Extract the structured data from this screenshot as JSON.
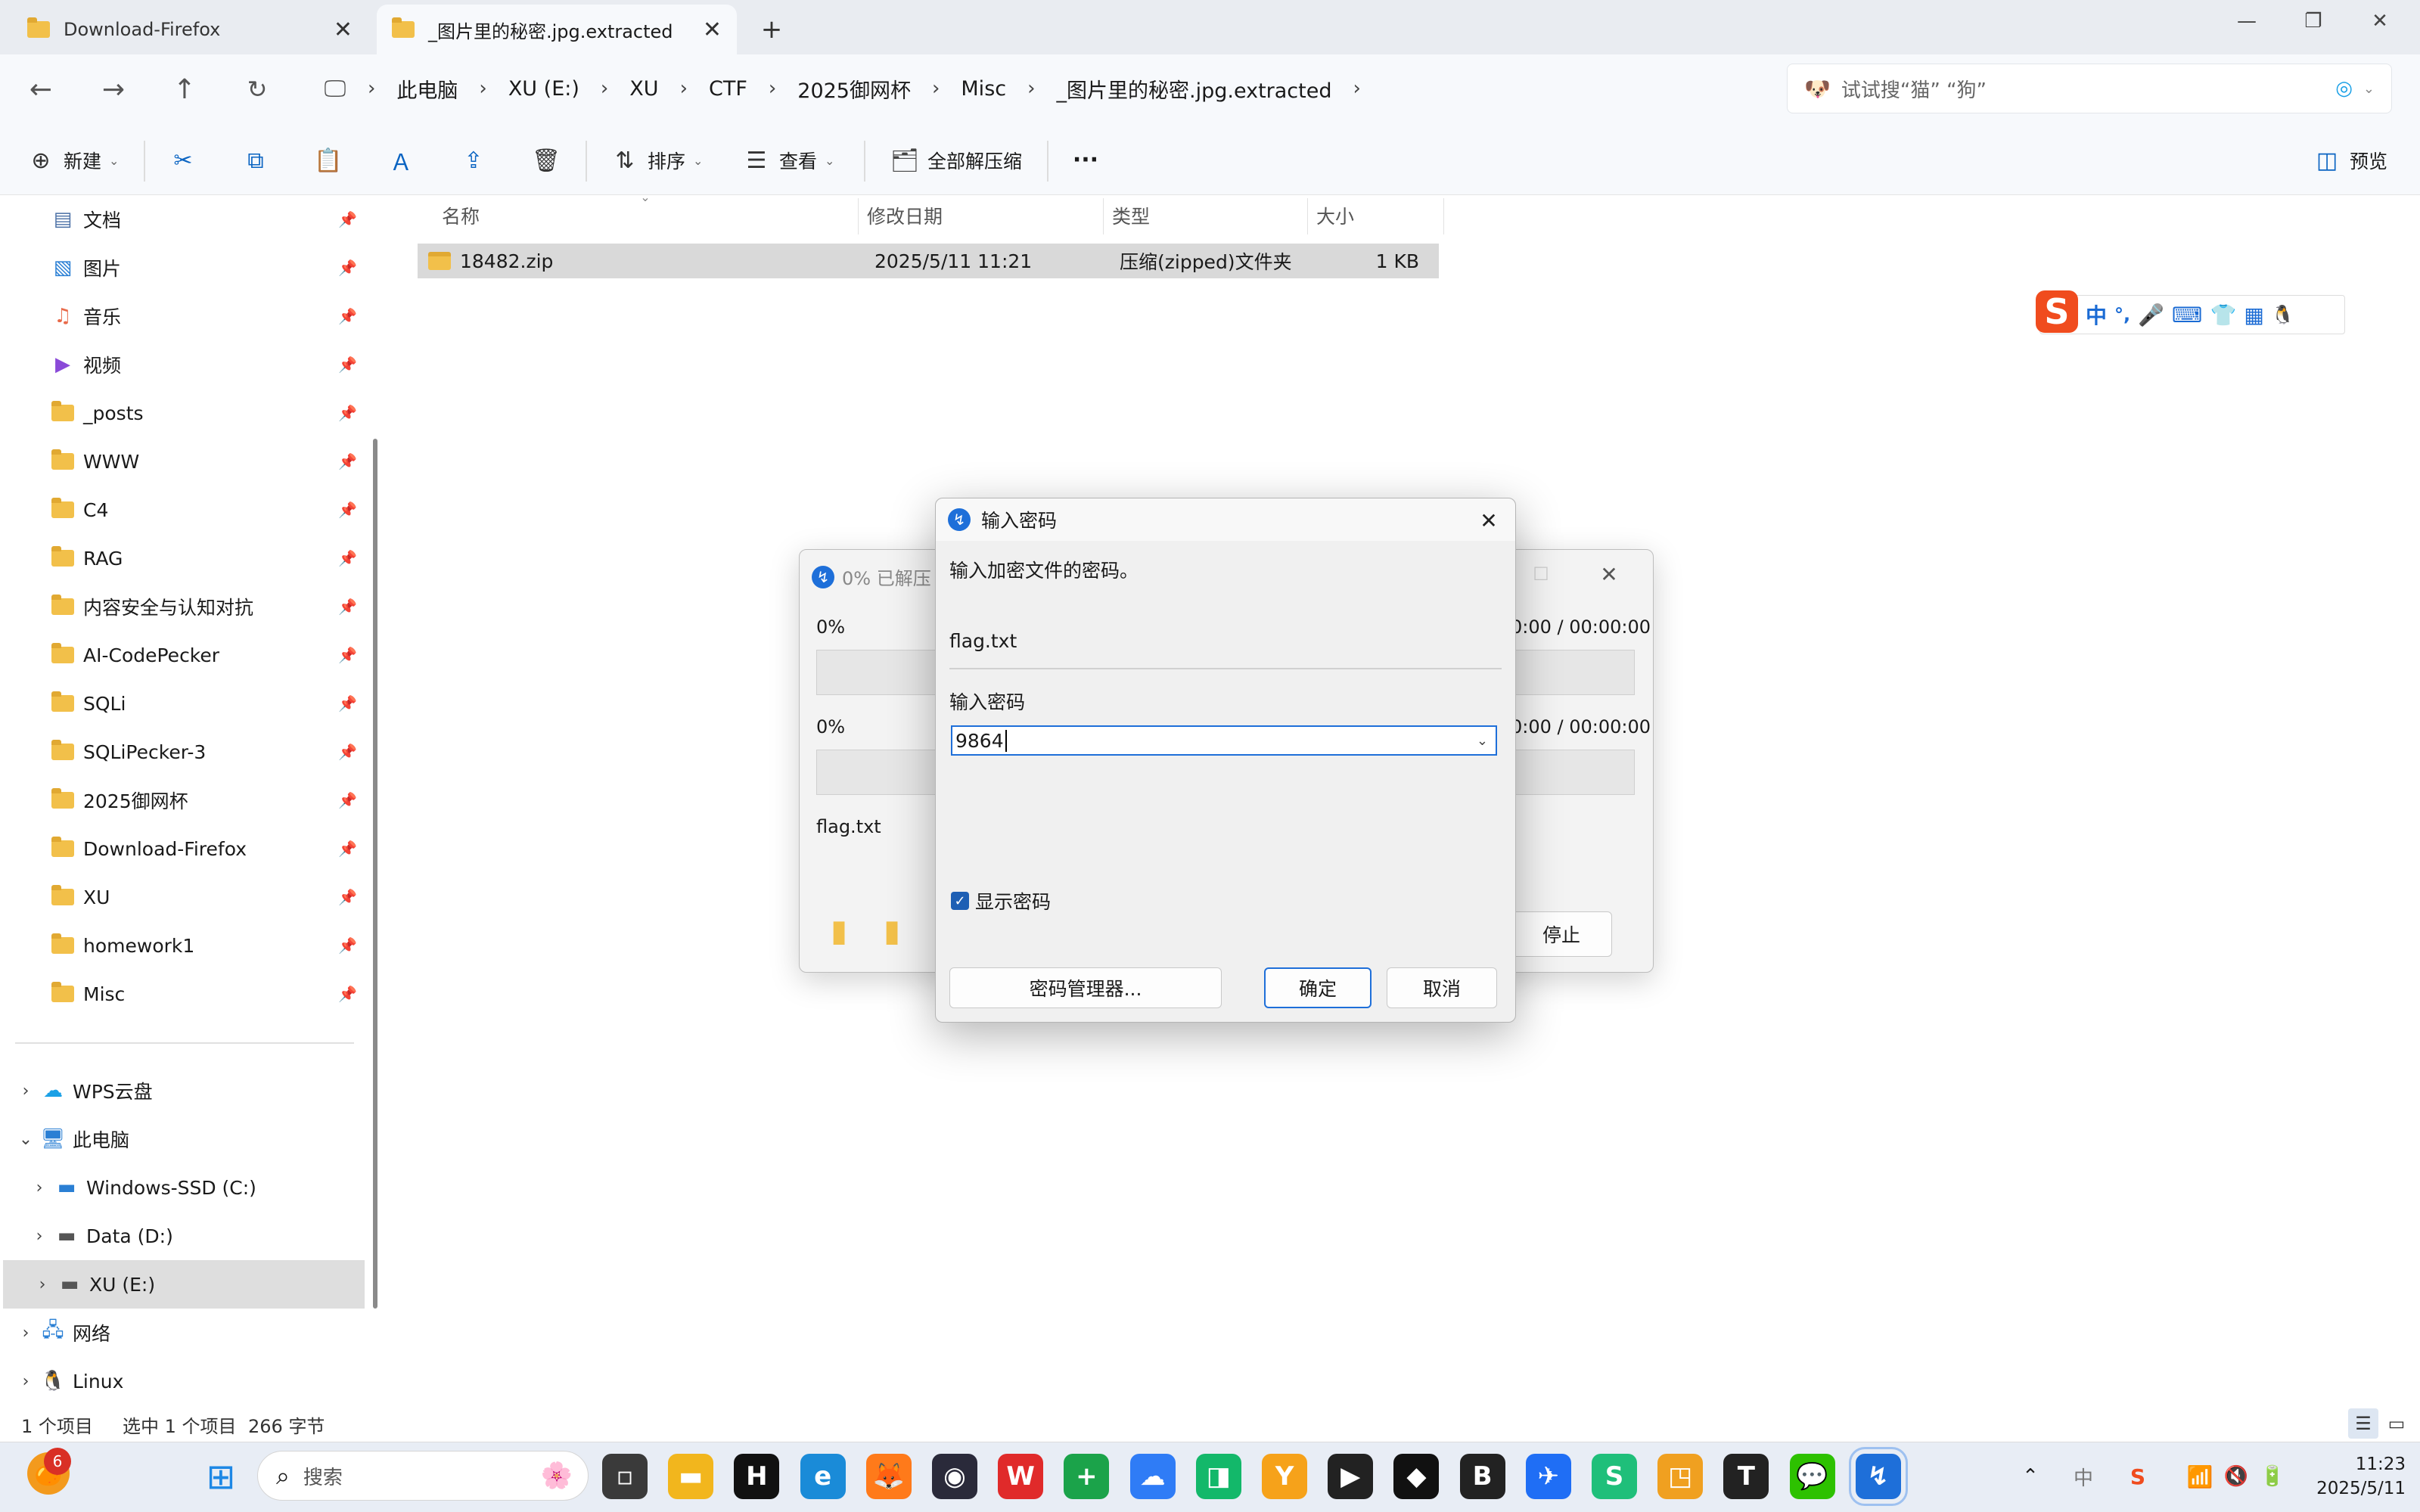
{
  "tabs": [
    {
      "label": "Download-Firefox"
    },
    {
      "label": "_图片里的秘密.jpg.extracted"
    }
  ],
  "window_controls": {
    "minimize": "—",
    "restore": "❐",
    "close": "✕"
  },
  "breadcrumb": [
    "此电脑",
    "XU (E:)",
    "XU",
    "CTF",
    "2025御网杯",
    "Misc",
    "_图片里的秘密.jpg.extracted"
  ],
  "search": {
    "placeholder": "试试搜“猫” “狗”"
  },
  "toolbar": {
    "new_label": "新建",
    "sort_label": "排序",
    "view_label": "查看",
    "extract_all_label": "全部解压缩",
    "more_label": "···",
    "preview_label": "预览"
  },
  "sidebar": {
    "quick": [
      {
        "label": "文档",
        "icon": "document-icon"
      },
      {
        "label": "图片",
        "icon": "pictures-icon"
      },
      {
        "label": "音乐",
        "icon": "music-icon"
      },
      {
        "label": "视频",
        "icon": "video-icon"
      },
      {
        "label": "_posts",
        "icon": "folder-icon"
      },
      {
        "label": "WWW",
        "icon": "folder-icon"
      },
      {
        "label": "C4",
        "icon": "folder-icon"
      },
      {
        "label": "RAG",
        "icon": "folder-icon"
      },
      {
        "label": "内容安全与认知对抗",
        "icon": "folder-icon"
      },
      {
        "label": "AI-CodePecker",
        "icon": "folder-icon"
      },
      {
        "label": "SQLi",
        "icon": "folder-icon"
      },
      {
        "label": "SQLiPecker-3",
        "icon": "folder-icon"
      },
      {
        "label": "2025御网杯",
        "icon": "folder-icon"
      },
      {
        "label": "Download-Firefox",
        "icon": "folder-icon"
      },
      {
        "label": "XU",
        "icon": "folder-icon"
      },
      {
        "label": "homework1",
        "icon": "folder-icon"
      },
      {
        "label": "Misc",
        "icon": "folder-icon"
      }
    ],
    "tree": [
      {
        "label": "WPS云盘"
      },
      {
        "label": "此电脑"
      },
      {
        "label": "Windows-SSD (C:)"
      },
      {
        "label": "Data (D:)"
      },
      {
        "label": "XU (E:)"
      },
      {
        "label": "网络"
      },
      {
        "label": "Linux"
      }
    ]
  },
  "columns": {
    "name": "名称",
    "modified": "修改日期",
    "type": "类型",
    "size": "大小"
  },
  "files": [
    {
      "name": "18482.zip",
      "modified": "2025/5/11 11:21",
      "type": "压缩(zipped)文件夹",
      "size": "1 KB"
    }
  ],
  "status": {
    "count": "1 个项目",
    "selection": "选中 1 个项目",
    "bytes": "266 字节"
  },
  "ime": {
    "lang": "中",
    "punct": "°,"
  },
  "progress_dialog": {
    "title": "0% 已解压 1",
    "pct1": "0%",
    "time1": "0:00 / 00:00:00",
    "pct2": "0%",
    "time2": "0:00 / 00:00:00",
    "file": "flag.txt",
    "stop_label": "停止"
  },
  "password_dialog": {
    "title": "输入密码",
    "prompt": "输入加密文件的密码。",
    "file": "flag.txt",
    "field_label": "输入密码",
    "value": "9864",
    "show_password_label": "显示密码",
    "show_password_checked": true,
    "manager_label": "密码管理器...",
    "ok_label": "确定",
    "cancel_label": "取消"
  },
  "taskbar": {
    "search_placeholder": "搜索",
    "badge": "6",
    "tray_lang": "中",
    "time": "11:23",
    "date": "2025/5/11"
  },
  "colors": {
    "accent": "#0a64c2",
    "folder": "#f2c04a",
    "selection": "#d9d9d9"
  }
}
